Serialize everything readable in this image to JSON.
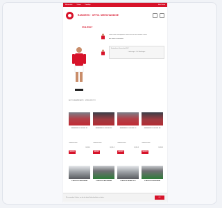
{
  "topbar": {
    "links": [
      "Mannschaft",
      "Tickets",
      "Fanshop"
    ],
    "right": "Mein Konto"
  },
  "header": {
    "brand": "RANGERS · OFFIZ. MERCHANDISE"
  },
  "product": {
    "section_title": "FAN-WELT",
    "info_line1": "Wähle dein Lieblingsmotiv und sichere dir das offizielle Poster.",
    "info_line2": "Alle Motive sind limitiert.",
    "box_line1": "Kostenloser Versand ab 30 €",
    "box_line2": "Lieferung in 2–4 Werktagen",
    "caption": "AUTOGRAMMKARTE · SPIELERFOTO"
  },
  "cards_row1": [
    {
      "title": "RANGERS POSTER 01",
      "desc": "Offizielles Motiv",
      "price": "12,95 €",
      "btn": "KAUFEN"
    },
    {
      "title": "RANGERS POSTER 02",
      "desc": "Offizielles Motiv",
      "price": "12,95 €",
      "btn": "KAUFEN"
    },
    {
      "title": "RANGERS POSTER 03",
      "desc": "Offizielles Motiv",
      "price": "12,95 €",
      "btn": "KAUFEN"
    },
    {
      "title": "RANGERS POSTER 04",
      "desc": "Offizielles Motiv",
      "price": "12,95 €",
      "btn": "KAUFEN"
    }
  ],
  "cards_row2": [
    {
      "title": "STADION PANORAMA"
    },
    {
      "title": "STADION PANORAMA"
    },
    {
      "title": "STADION FANBLOCK"
    },
    {
      "title": "STADION PANORAMA"
    }
  ],
  "cookie": {
    "text": "Wir verwenden Cookies, um dir das beste Einkaufserlebnis zu bieten.",
    "button": "OK"
  },
  "colors": {
    "brand": "#d7132a"
  }
}
